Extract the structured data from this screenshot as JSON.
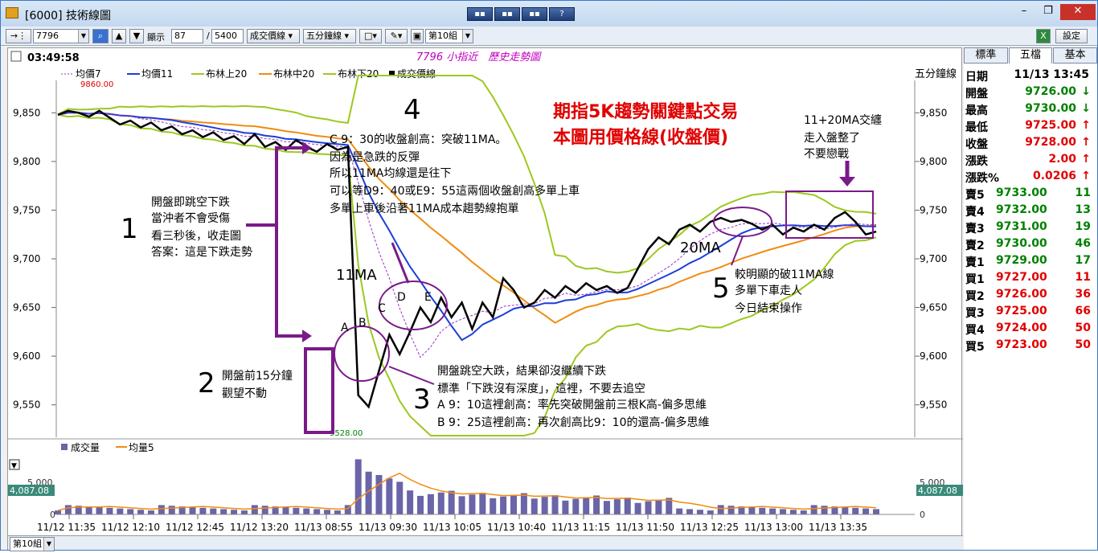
{
  "window": {
    "title": "[6000] 技術線圖",
    "buttons": [
      "▪▪",
      "▪▪",
      "▪▪",
      "?"
    ]
  },
  "toolbar": {
    "symbol": "7796",
    "display_label": "顯示",
    "display_from": "87",
    "display_to": "5400",
    "chart_type": "成交價線",
    "period": "五分鐘線",
    "group": "第10組",
    "settings": "設定"
  },
  "chart": {
    "time": "03:49:58",
    "title": "7796 小指近　歷史走勢圖",
    "period_label": "五分鐘線",
    "legend": [
      "均價7",
      "均價11",
      "布林上20",
      "布林中20",
      "布林下20",
      "成交價線"
    ],
    "y_ticks": [
      "9,850",
      "9,800",
      "9,750",
      "9,700",
      "9,650",
      "9,600",
      "9,550"
    ],
    "high_label": "9860.00",
    "low_label": "9528.00",
    "volume_legend": [
      "成交量",
      "均量5"
    ],
    "volume_value": "4,087.08",
    "volume_tick": "5,000",
    "volume_zero": "0",
    "x_ticks": [
      "11/12 11:35",
      "11/12 12:10",
      "11/12 12:45",
      "11/12 13:20",
      "11/13 08:55",
      "11/13 09:30",
      "11/13 10:05",
      "11/13 10:40",
      "11/13 11:15",
      "11/13 11:50",
      "11/13 12:25",
      "11/13 13:00",
      "11/13 13:35"
    ],
    "bottom_group": "第10組",
    "colors": {
      "ma7": "#9b30c8",
      "ma11": "#1c3fd8",
      "boll_band": "#9cc820",
      "boll_mid": "#f08c10",
      "price": "#000000",
      "annotation": "#7a1a8a",
      "title": "#c000c0",
      "headline": "#e00000"
    }
  },
  "annotations": {
    "n1": "1",
    "t1": [
      "開盤即跳空下跌",
      "當沖者不會受傷",
      "看三秒後，收走圖",
      "答案：這是下跌走勢"
    ],
    "n2": "2",
    "t2": [
      "開盤前15分鐘",
      "觀望不動"
    ],
    "n3": "3",
    "t3": [
      "開盤跳空大跌，結果卻沒繼續下跌",
      "標準「下跌沒有深度」，這裡，不要去追空",
      "A 9：10這裡創高：率先突破開盤前三根K高-偏多思維",
      "B 9：25這裡創高：再次創高比9：10的還高-偏多思維"
    ],
    "n4": "4",
    "t4": [
      "C 9：30的收盤創高：突破11MA。",
      "因為是急跌的反彈",
      "所以11MA均線還是往下",
      "可以等D9：40或E9：55這兩個收盤創高多單上車",
      "多單上車後沿著11MA成本趨勢線抱單"
    ],
    "n5": "5",
    "t5": [
      "較明顯的破11MA線",
      "多單下車走人",
      "今日結束操作"
    ],
    "headline": [
      "期指5K趨勢關鍵點交易",
      "本圖用價格線(收盤價)"
    ],
    "t6": [
      "11+20MA交纏",
      "走入盤整了",
      "不要戀戰"
    ],
    "ma11_label": "11MA",
    "ma20_label": "20MA",
    "letters": [
      "A",
      "B",
      "C",
      "D",
      "E"
    ]
  },
  "side": {
    "tabs": [
      "標準",
      "五檔",
      "基本"
    ],
    "date_label": "日期",
    "date_value": "11/13 13:45",
    "fields": [
      {
        "label": "開盤",
        "value": "9726.00",
        "color": "green",
        "arrow": "↓"
      },
      {
        "label": "最高",
        "value": "9730.00",
        "color": "green",
        "arrow": "↓"
      },
      {
        "label": "最低",
        "value": "9725.00",
        "color": "red",
        "arrow": "↑"
      },
      {
        "label": "收盤",
        "value": "9728.00",
        "color": "red",
        "arrow": "↑"
      },
      {
        "label": "漲跌",
        "value": "2.00",
        "color": "red",
        "arrow": "↑"
      },
      {
        "label": "漲跌%",
        "value": "0.0206",
        "color": "red",
        "arrow": "↑"
      }
    ],
    "book": [
      {
        "label": "賣5",
        "price": "9733.00",
        "qty": "11",
        "color": "green"
      },
      {
        "label": "賣4",
        "price": "9732.00",
        "qty": "13",
        "color": "green"
      },
      {
        "label": "賣3",
        "price": "9731.00",
        "qty": "19",
        "color": "green"
      },
      {
        "label": "賣2",
        "price": "9730.00",
        "qty": "46",
        "color": "green"
      },
      {
        "label": "賣1",
        "price": "9729.00",
        "qty": "17",
        "color": "green"
      },
      {
        "label": "買1",
        "price": "9727.00",
        "qty": "11",
        "color": "red"
      },
      {
        "label": "買2",
        "price": "9726.00",
        "qty": "36",
        "color": "red"
      },
      {
        "label": "買3",
        "price": "9725.00",
        "qty": "66",
        "color": "red"
      },
      {
        "label": "買4",
        "price": "9724.00",
        "qty": "50",
        "color": "red"
      },
      {
        "label": "買5",
        "price": "9723.00",
        "qty": "50",
        "color": "red"
      }
    ]
  },
  "chart_data": {
    "type": "line",
    "y_range": [
      9520,
      9880
    ],
    "price": [
      9848,
      9852,
      9850,
      9846,
      9852,
      9845,
      9838,
      9842,
      9835,
      9840,
      9832,
      9836,
      9828,
      9832,
      9825,
      9830,
      9822,
      9826,
      9818,
      9828,
      9815,
      9820,
      9812,
      9822,
      9815,
      9810,
      9818,
      9812,
      9815,
      9560,
      9548,
      9585,
      9622,
      9602,
      9625,
      9650,
      9635,
      9660,
      9640,
      9655,
      9628,
      9655,
      9640,
      9680,
      9668,
      9650,
      9655,
      9668,
      9660,
      9672,
      9665,
      9675,
      9668,
      9672,
      9665,
      9670,
      9690,
      9710,
      9722,
      9715,
      9730,
      9735,
      9728,
      9738,
      9742,
      9738,
      9740,
      9736,
      9730,
      9735,
      9725,
      9732,
      9728,
      9735,
      9730,
      9742,
      9748,
      9738,
      9725,
      9728
    ]
  }
}
